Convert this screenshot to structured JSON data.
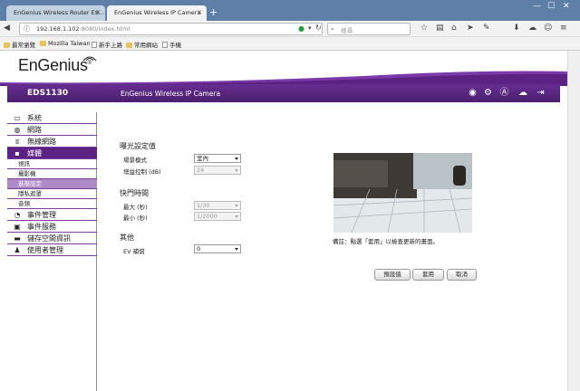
{
  "browser": {
    "tabs": [
      {
        "label": "EnGenius Wireless Router ES..."
      },
      {
        "label": "EnGenius Wireless IP Camera"
      }
    ],
    "url_host": "192.168.1.102",
    "url_rest": ":8080/index.html",
    "search_placeholder": "搜尋",
    "bookmarks": [
      "最常瀏覽",
      "Mozilla Taiwan",
      "新手上路",
      "常用網站",
      "手機"
    ]
  },
  "app": {
    "logo": "EnGenius",
    "model": "EDS1130",
    "product_name": "EnGenius Wireless IP Camera"
  },
  "sidebar": {
    "items": [
      {
        "label": "系統",
        "icon": "monitor-icon"
      },
      {
        "label": "網路",
        "icon": "globe-icon"
      },
      {
        "label": "無線網路",
        "icon": "wireless-icon"
      },
      {
        "label": "媒體",
        "icon": "media-icon"
      },
      {
        "label": "視訊"
      },
      {
        "label": "攝影機"
      },
      {
        "label": "進階設定"
      },
      {
        "label": "隱私遮罩"
      },
      {
        "label": "音頻"
      },
      {
        "label": "事件管理",
        "icon": "event-icon"
      },
      {
        "label": "事件服務",
        "icon": "service-icon"
      },
      {
        "label": "儲存空間資訊",
        "icon": "storage-icon"
      },
      {
        "label": "使用者管理",
        "icon": "users-icon"
      }
    ]
  },
  "form": {
    "exposure_title": "曝光設定值",
    "scene_label": "場景模式",
    "scene_value": "室內",
    "brightness_label": "增益控制 (dB)",
    "brightness_value": "24",
    "shutter_title": "快門時間",
    "max_label": "最大 (秒)",
    "max_value": "1/30",
    "min_label": "最小 (秒)",
    "min_value": "1/2000",
    "other_title": "其他",
    "ev_label": "EV 補償",
    "ev_value": "0"
  },
  "preview_note": "備註：點選「套用」以檢查更新的畫面。",
  "buttons": {
    "default": "預設值",
    "apply": "套用",
    "cancel": "取消"
  },
  "colors": {
    "brand_purple": "#5b2283",
    "accent_light": "#b08ac7",
    "tab_bar": "#5d7fa8"
  }
}
